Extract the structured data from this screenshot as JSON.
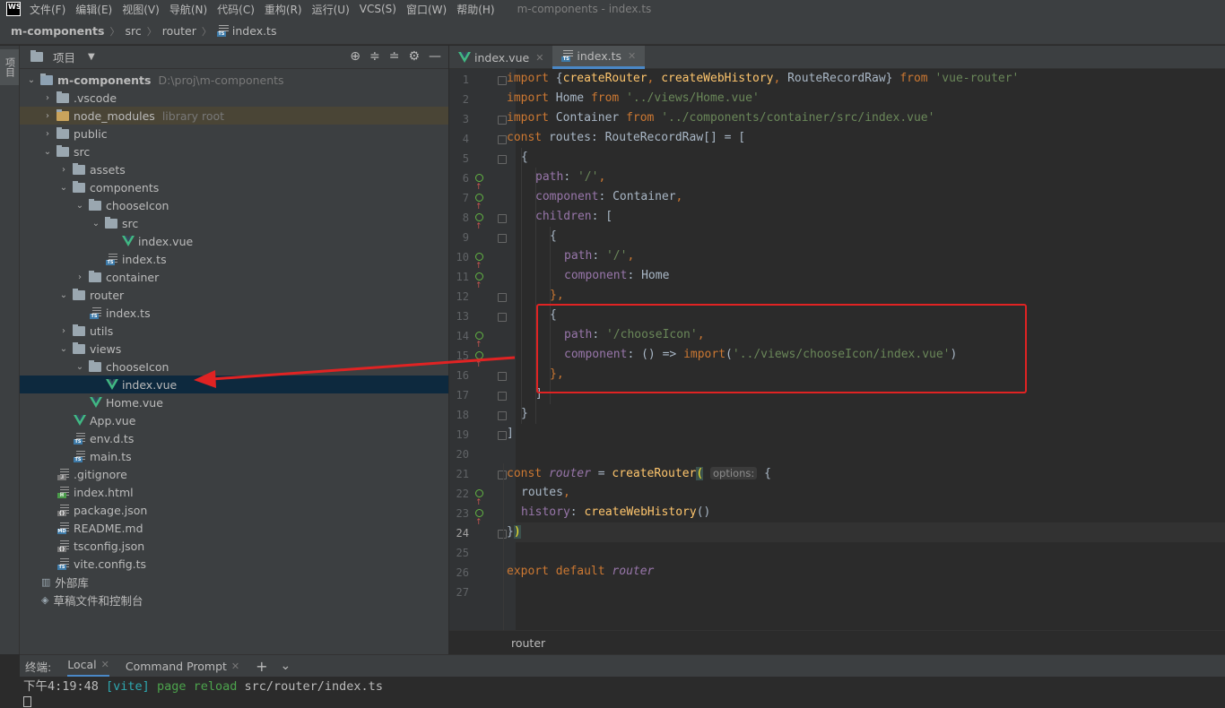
{
  "menubar": {
    "logo": "WS",
    "items": [
      "文件(F)",
      "编辑(E)",
      "视图(V)",
      "导航(N)",
      "代码(C)",
      "重构(R)",
      "运行(U)",
      "VCS(S)",
      "窗口(W)",
      "帮助(H)"
    ],
    "window_title": "m-components - index.ts"
  },
  "navbar": {
    "crumbs": [
      "m-components",
      "src",
      "router",
      "index.ts"
    ]
  },
  "left_strip": {
    "tab_label": "项目"
  },
  "project_panel": {
    "title": "项目",
    "tree": [
      {
        "name": "m-components",
        "hint": "D:\\proj\\m-components"
      },
      {
        "name": ".vscode"
      },
      {
        "name": "node_modules",
        "hint": "library root"
      },
      {
        "name": "public"
      },
      {
        "name": "src"
      },
      {
        "name": "assets"
      },
      {
        "name": "components"
      },
      {
        "name": "chooseIcon"
      },
      {
        "name": "src"
      },
      {
        "name": "index.vue"
      },
      {
        "name": "index.ts"
      },
      {
        "name": "container"
      },
      {
        "name": "router"
      },
      {
        "name": "index.ts"
      },
      {
        "name": "utils"
      },
      {
        "name": "views"
      },
      {
        "name": "chooseIcon"
      },
      {
        "name": "index.vue"
      },
      {
        "name": "Home.vue"
      },
      {
        "name": "App.vue"
      },
      {
        "name": "env.d.ts"
      },
      {
        "name": "main.ts"
      },
      {
        "name": ".gitignore"
      },
      {
        "name": "index.html"
      },
      {
        "name": "package.json"
      },
      {
        "name": "README.md"
      },
      {
        "name": "tsconfig.json"
      },
      {
        "name": "vite.config.ts"
      },
      {
        "name": "外部库"
      },
      {
        "name": "草稿文件和控制台"
      }
    ]
  },
  "editor": {
    "tabs": [
      {
        "label": "index.vue"
      },
      {
        "label": "index.ts"
      }
    ],
    "line_numbers": [
      "1",
      "2",
      "3",
      "4",
      "5",
      "6",
      "7",
      "8",
      "9",
      "10",
      "11",
      "12",
      "13",
      "14",
      "15",
      "16",
      "17",
      "18",
      "19",
      "20",
      "21",
      "22",
      "23",
      "24",
      "25",
      "26",
      "27"
    ],
    "code": {
      "l1": [
        "import",
        "{",
        "createRouter",
        ",",
        "createWebHistory",
        ",",
        "RouteRecordRaw}",
        "from",
        "'vue-router'"
      ],
      "l2": [
        "import",
        "Home",
        "from",
        "'../views/Home.vue'"
      ],
      "l3": [
        "import",
        "Container",
        "from",
        "'../components/container/src/index.vue'"
      ],
      "l4": [
        "const",
        "routes: RouteRecordRaw[] = ["
      ],
      "l5": "{",
      "l6": [
        "path",
        ": ",
        "'/'",
        ","
      ],
      "l7": [
        "component",
        ": Container",
        ","
      ],
      "l8": [
        "children",
        ": ["
      ],
      "l9": "{",
      "l10": [
        "path",
        ": ",
        "'/'",
        ","
      ],
      "l11": [
        "component",
        ": Home"
      ],
      "l12": [
        "},"
      ],
      "l13": "{",
      "l14": [
        "path",
        ": ",
        "'/chooseIcon'",
        ","
      ],
      "l15": [
        "component",
        ": () => ",
        "import",
        "(",
        "'../views/chooseIcon/index.vue'",
        ")"
      ],
      "l16": [
        "},"
      ],
      "l17": "]",
      "l18": "}",
      "l19": "]",
      "l21": [
        "const",
        "router",
        "=",
        "createRouter",
        "(",
        "options:",
        "{"
      ],
      "l22": [
        "routes",
        ","
      ],
      "l23": [
        "history",
        ": ",
        "createWebHistory",
        "()"
      ],
      "l24": [
        "}",
        ")"
      ],
      "l26": [
        "export",
        "default",
        "router"
      ]
    },
    "breadcrumb": "router"
  },
  "terminal": {
    "label": "终端:",
    "tabs": [
      {
        "label": "Local"
      },
      {
        "label": "Command Prompt"
      }
    ],
    "add_icon": "+",
    "dropdown_icon": "⌄",
    "line": {
      "time": "下午4:19:48",
      "tag": "[vite]",
      "msg": "page reload",
      "path": "src/router/index.ts"
    }
  },
  "colors": {
    "accent": "#4a88c7",
    "annotation_red": "#e02323",
    "selection": "#0d293e"
  }
}
